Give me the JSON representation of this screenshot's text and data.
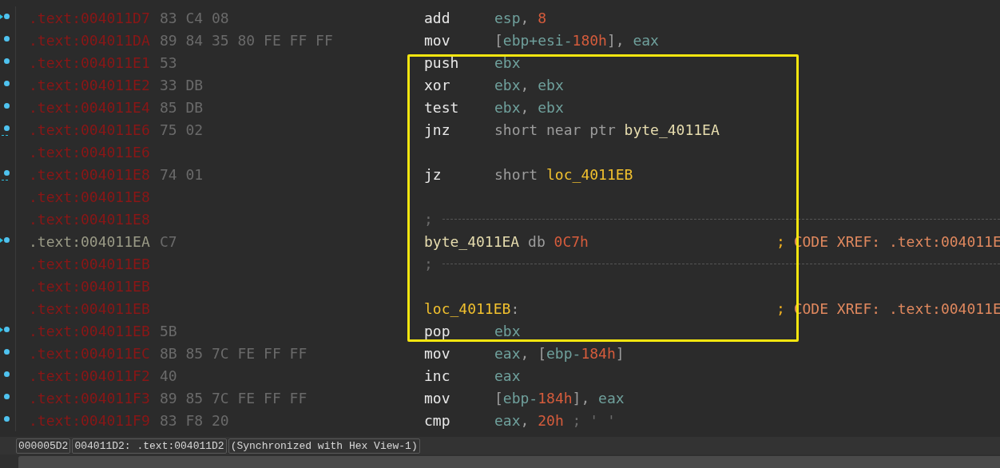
{
  "listing": [
    {
      "boxed": false,
      "rows": [
        {
          "address": {
            "text": ".text:004011D7",
            "color": "#8a1616"
          },
          "bytes": "83 C4 08",
          "dot": true,
          "arrow": true,
          "kind": "instr",
          "mnemonic": "add",
          "operands": [
            {
              "text": "esp",
              "kind": "reg"
            },
            {
              "text": ", ",
              "kind": "plain"
            },
            {
              "text": "8",
              "kind": "num"
            }
          ]
        },
        {
          "address": {
            "text": ".text:004011DA",
            "color": "#8a1616"
          },
          "bytes": "89 84 35 80 FE FF FF",
          "dot": true,
          "kind": "instr",
          "mnemonic": "mov",
          "operands": [
            {
              "text": "[",
              "kind": "plain"
            },
            {
              "text": "ebp+esi-",
              "kind": "reg"
            },
            {
              "text": "180h",
              "kind": "num"
            },
            {
              "text": "], ",
              "kind": "plain"
            },
            {
              "text": "eax",
              "kind": "reg"
            }
          ]
        }
      ]
    },
    {
      "boxed": true,
      "rows": [
        {
          "address": {
            "text": ".text:004011E1",
            "color": "#8a1616"
          },
          "bytes": "53",
          "dot": true,
          "kind": "instr",
          "mnemonic": "push",
          "operands": [
            {
              "text": "ebx",
              "kind": "reg"
            }
          ]
        },
        {
          "address": {
            "text": ".text:004011E2",
            "color": "#8a1616"
          },
          "bytes": "33 DB",
          "dot": true,
          "kind": "instr",
          "mnemonic": "xor",
          "operands": [
            {
              "text": "ebx",
              "kind": "reg"
            },
            {
              "text": ", ",
              "kind": "plain"
            },
            {
              "text": "ebx",
              "kind": "reg"
            }
          ]
        },
        {
          "address": {
            "text": ".text:004011E4",
            "color": "#8a1616"
          },
          "bytes": "85 DB",
          "dot": true,
          "kind": "instr",
          "mnemonic": "test",
          "operands": [
            {
              "text": "ebx",
              "kind": "reg"
            },
            {
              "text": ", ",
              "kind": "plain"
            },
            {
              "text": "ebx",
              "kind": "reg"
            }
          ]
        },
        {
          "address": {
            "text": ".text:004011E6",
            "color": "#8a1616"
          },
          "bytes": "75 02",
          "dot": true,
          "dash": true,
          "kind": "instr",
          "mnemonic": "jnz",
          "operands": [
            {
              "text": "short near ptr ",
              "kind": "plain"
            },
            {
              "text": "byte_4011EA",
              "kind": "data_name"
            }
          ]
        },
        {
          "address": {
            "text": ".text:004011E6",
            "color": "#8a1616"
          },
          "dot": false,
          "kind": "blank"
        },
        {
          "address": {
            "text": ".text:004011E8",
            "color": "#8a1616"
          },
          "bytes": "74 01",
          "dot": true,
          "dash": true,
          "kind": "instr",
          "mnemonic": "jz",
          "operands": [
            {
              "text": "short ",
              "kind": "plain"
            },
            {
              "text": "loc_4011EB",
              "kind": "loc_name"
            }
          ]
        },
        {
          "address": {
            "text": ".text:004011E8",
            "color": "#8a1616"
          },
          "dot": false,
          "kind": "blank"
        },
        {
          "address": {
            "text": ".text:004011E8",
            "color": "#8a1616"
          },
          "dot": false,
          "kind": "separator",
          "operands": [
            {
              "text": ";",
              "kind": "dim"
            }
          ]
        },
        {
          "address": {
            "text": ".text:004011EA",
            "color": "#9a9a86"
          },
          "bytes": "C7",
          "dot": true,
          "arrow": true,
          "kind": "data",
          "operands": [
            {
              "text": "byte_4011EA",
              "kind": "data_name"
            },
            {
              "text": " db ",
              "kind": "plain"
            },
            {
              "text": "0C7h",
              "kind": "num"
            }
          ],
          "comment": [
            {
              "text": "; ",
              "kind": "semi"
            },
            {
              "text": "CODE XREF: .text:004011E",
              "kind": "comment"
            }
          ]
        },
        {
          "address": {
            "text": ".text:004011EB",
            "color": "#8a1616"
          },
          "dot": false,
          "kind": "separator",
          "operands": [
            {
              "text": ";",
              "kind": "dim"
            }
          ]
        },
        {
          "address": {
            "text": ".text:004011EB",
            "color": "#8a1616"
          },
          "dot": false,
          "kind": "blank"
        },
        {
          "address": {
            "text": ".text:004011EB",
            "color": "#8a1616"
          },
          "dot": false,
          "kind": "label",
          "operands": [
            {
              "text": "loc_4011EB",
              "kind": "loc_name"
            },
            {
              "text": ":",
              "kind": "plain"
            }
          ],
          "comment": [
            {
              "text": "; ",
              "kind": "semi"
            },
            {
              "text": "CODE XREF: .text:004011E",
              "kind": "comment"
            }
          ]
        },
        {
          "address": {
            "text": ".text:004011EB",
            "color": "#8a1616"
          },
          "bytes": "5B",
          "dot": true,
          "arrow": true,
          "kind": "instr",
          "mnemonic": "pop",
          "operands": [
            {
              "text": "ebx",
              "kind": "reg"
            }
          ]
        }
      ]
    },
    {
      "boxed": false,
      "rows": [
        {
          "address": {
            "text": ".text:004011EC",
            "color": "#8a1616"
          },
          "bytes": "8B 85 7C FE FF FF",
          "dot": true,
          "kind": "instr",
          "mnemonic": "mov",
          "operands": [
            {
              "text": "eax",
              "kind": "reg"
            },
            {
              "text": ", [",
              "kind": "plain"
            },
            {
              "text": "ebp-",
              "kind": "reg"
            },
            {
              "text": "184h",
              "kind": "num"
            },
            {
              "text": "]",
              "kind": "plain"
            }
          ]
        },
        {
          "address": {
            "text": ".text:004011F2",
            "color": "#8a1616"
          },
          "bytes": "40",
          "dot": true,
          "kind": "instr",
          "mnemonic": "inc",
          "operands": [
            {
              "text": "eax",
              "kind": "reg"
            }
          ]
        },
        {
          "address": {
            "text": ".text:004011F3",
            "color": "#8a1616"
          },
          "bytes": "89 85 7C FE FF FF",
          "dot": true,
          "kind": "instr",
          "mnemonic": "mov",
          "operands": [
            {
              "text": "[",
              "kind": "plain"
            },
            {
              "text": "ebp-",
              "kind": "reg"
            },
            {
              "text": "184h",
              "kind": "num"
            },
            {
              "text": "], ",
              "kind": "plain"
            },
            {
              "text": "eax",
              "kind": "reg"
            }
          ]
        },
        {
          "address": {
            "text": ".text:004011F9",
            "color": "#8a1616"
          },
          "bytes": "83 F8 20",
          "dot": true,
          "kind": "instr",
          "mnemonic": "cmp",
          "operands": [
            {
              "text": "eax",
              "kind": "reg"
            },
            {
              "text": ", ",
              "kind": "plain"
            },
            {
              "text": "20h",
              "kind": "num"
            },
            {
              "text": " ; ' '",
              "kind": "dim"
            }
          ]
        }
      ]
    }
  ],
  "status_bar": [
    "000005D2",
    "004011D2: .text:004011D2",
    "(Synchronized with Hex View-1)"
  ]
}
